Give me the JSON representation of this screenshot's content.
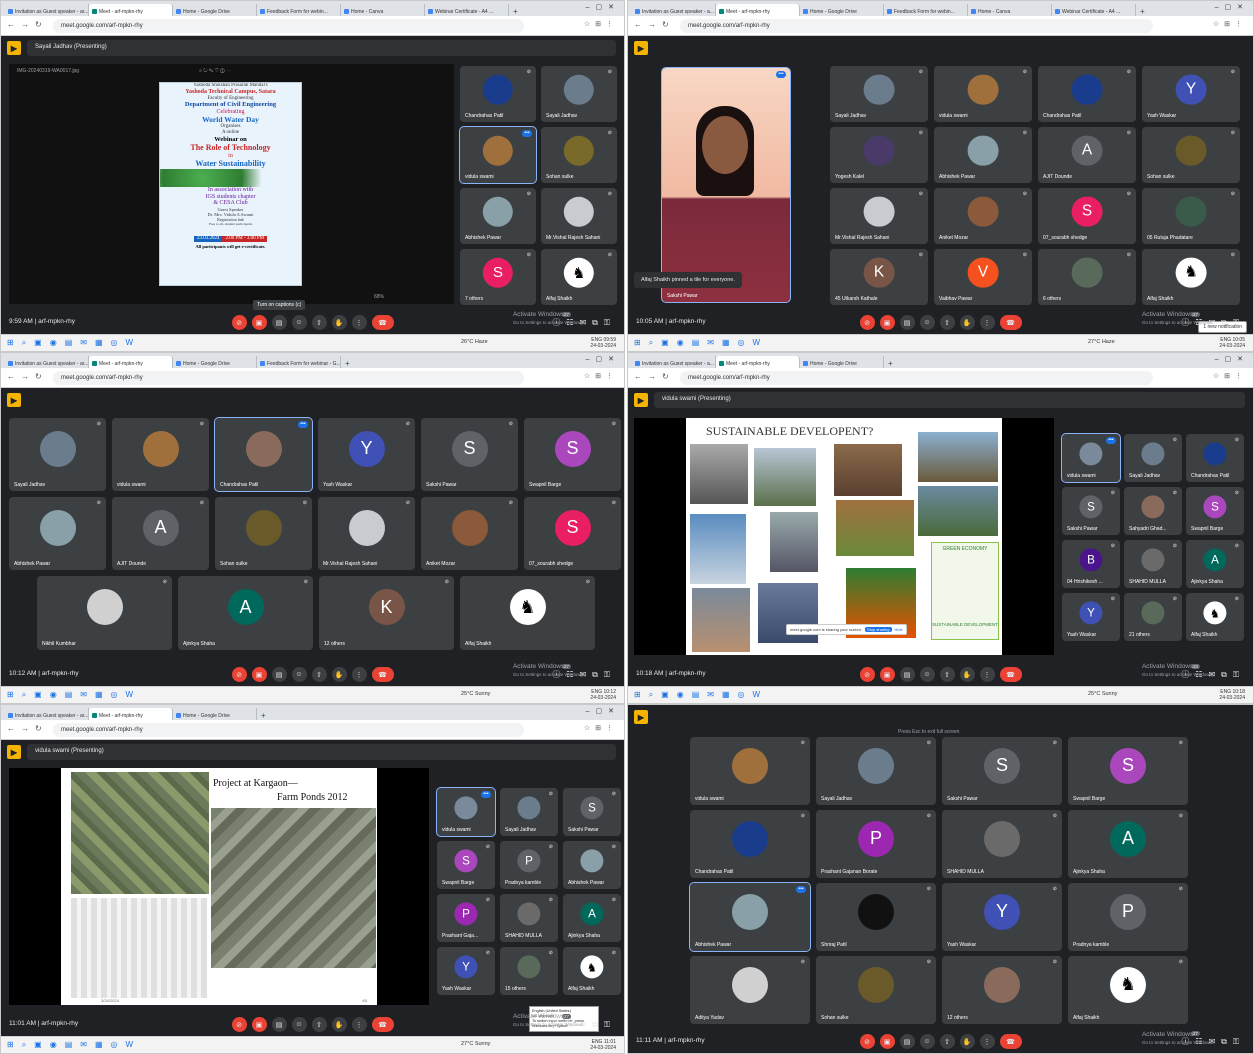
{
  "panels": [
    {
      "tabs": [
        "Invitation as Guest speaker - ar...",
        "Meet - arf-mpkn-rhy",
        "Home - Google Drive",
        "Feedback Form for webin...",
        "Home - Canva",
        "Webinar Certificate - A4 ..."
      ],
      "url": "meet.google.com/arf-mpkn-rhy",
      "presenting": "Sayali Jadhav (Presenting)",
      "image_title": "IMG-20240319-WA0017.jpg",
      "zoom": "68%",
      "poster": {
        "l1": "Yashoda Shikshan Prasarak Mandal's",
        "l2": "Yashoda Technical Campus, Satara",
        "l3": "Faculty of Engineering",
        "l4": "Department of Civil Engineering",
        "l5": "Celebrating",
        "l6": "World Water Day",
        "l7": "Organises",
        "l8": "A online",
        "l9": "Webinar on",
        "l10": "The Role of Technology",
        "l11": "in",
        "l12": "Water Sustainability",
        "l13": "In association with",
        "l14": "IGS students chapter",
        "l15": "& CESA Club",
        "l16": "Guest Speaker",
        "l17": "Dr. Mrs. Vidula A.Swami",
        "l18": "Registration link",
        "l19": "Free to all, student participants",
        "l20": "23.03.2024",
        "l21": "2.00 PM - 3.00 PM",
        "l22": "All participants will get e-certificate."
      },
      "tiles": [
        {
          "name": "Chandrahas Patil",
          "av": "",
          "color": "#1a3c8c"
        },
        {
          "name": "Sayali Jadhav",
          "av": "",
          "color": "#6b7d8c"
        },
        {
          "name": "vidula swami",
          "av": "",
          "color": "#a0703c",
          "spk": true
        },
        {
          "name": "Sohan sulke",
          "av": "",
          "color": "#7a6a2a"
        },
        {
          "name": "Abhishek Pawar",
          "av": "",
          "color": "#8aa0a8"
        },
        {
          "name": "Mr.Vishal Rajesh Sahani",
          "av": "",
          "color": "#c8ccd0"
        },
        {
          "name": "7 others",
          "av": "S",
          "color": "#e91e63"
        },
        {
          "name": "Alfaj Shaikh",
          "av": "♞",
          "color": "#ffffff"
        }
      ],
      "tooltip": "Turn on captions (c)",
      "time": "9:59 AM",
      "code": "arf-mpkn-rhy",
      "activate": "Activate Windows",
      "activate_sub": "Go to Settings to activate Windows.",
      "weather": "26°C  Haze",
      "tray_time": "09:59",
      "tray_date": "24-03-2024",
      "lang": "ENG",
      "people": "27"
    },
    {
      "tabs": [
        "Invitation as Guest speaker - a...",
        "Meet - arf-mpkn-rhy",
        "Home - Google Drive",
        "Feedback Form for webin...",
        "Home - Canva",
        "Webinar Certificate - A4 ..."
      ],
      "url": "meet.google.com/arf-mpkn-rhy",
      "pinned_name": "Sakshi Pawar",
      "toast": "Alfaj Shaikh pinned a tile for everyone.",
      "tiles": [
        {
          "name": "Sayali Jadhav",
          "av": "",
          "color": "#6b7d8c"
        },
        {
          "name": "vidula swami",
          "av": "",
          "color": "#a0703c"
        },
        {
          "name": "Chandrahas Patil",
          "av": "",
          "color": "#1a3c8c"
        },
        {
          "name": "Yash Waskar",
          "av": "Y",
          "color": "#3f51b5"
        },
        {
          "name": "Yogesh Kalel",
          "av": "",
          "color": "#4a3a6a"
        },
        {
          "name": "Abhishek Pawar",
          "av": "",
          "color": "#8aa0a8"
        },
        {
          "name": "AJIT Dounde",
          "av": "A",
          "color": "#5f6368"
        },
        {
          "name": "Sohan sulke",
          "av": "",
          "color": "#6a5a2a"
        },
        {
          "name": "Mr.Vishal Rajesh Sahani",
          "av": "",
          "color": "#c8ccd0"
        },
        {
          "name": "Aniket Mozar",
          "av": "",
          "color": "#8a5a3a"
        },
        {
          "name": "07_sourabh shedge",
          "av": "S",
          "color": "#e91e63"
        },
        {
          "name": "05 Rutuja Phadatare",
          "av": "",
          "color": "#3a5a4a"
        },
        {
          "name": "45 Utkarsh Kathale",
          "av": "K",
          "color": "#795548"
        },
        {
          "name": "Vaibhav Pawar",
          "av": "V",
          "color": "#f4511e"
        },
        {
          "name": "6 others",
          "av": "",
          "color": "#5a6a5a"
        },
        {
          "name": "Alfaj Shaikh",
          "av": "♞",
          "color": "#ffffff"
        }
      ],
      "time": "10:05 AM",
      "code": "arf-mpkn-rhy",
      "activate": "Activate Windows",
      "activate_sub": "Go to Settings to activate Windows.",
      "weather": "27°C  Haze",
      "tray_time": "10:05",
      "tray_date": "24-03-2024",
      "lang": "ENG",
      "people": "27",
      "notif": "1 new notification"
    },
    {
      "tabs": [
        "Invitation as Guest speaker - ar...",
        "Meet - arf-mpkn-rhy",
        "Home - Google Drive",
        "Feedback Form for webinar - G..."
      ],
      "url": "meet.google.com/arf-mpkn-rhy",
      "tiles": [
        {
          "name": "Sayali Jadhav",
          "av": "",
          "color": "#6b7d8c"
        },
        {
          "name": "vidula swami",
          "av": "",
          "color": "#a0703c"
        },
        {
          "name": "Chandrahas Patil",
          "av": "",
          "color": "#8a6a5a",
          "spk": true
        },
        {
          "name": "Yash Waskar",
          "av": "Y",
          "color": "#3f51b5"
        },
        {
          "name": "Sakshi Pawar",
          "av": "S",
          "color": "#5f6368"
        },
        {
          "name": "Swapnil Barge",
          "av": "S",
          "color": "#ab47bc"
        },
        {
          "name": "Abhishek Pawar",
          "av": "",
          "color": "#8aa0a8"
        },
        {
          "name": "AJIT Dounde",
          "av": "A",
          "color": "#5f6368"
        },
        {
          "name": "Sohan sulke",
          "av": "",
          "color": "#6a5a2a"
        },
        {
          "name": "Mr.Vishal Rajesh Sahani",
          "av": "",
          "color": "#c8ccd0"
        },
        {
          "name": "Aniket Mozar",
          "av": "",
          "color": "#8a5a3a"
        },
        {
          "name": "07_sourabh shedge",
          "av": "S",
          "color": "#e91e63"
        },
        {
          "name": "Nikhil Kumbhar",
          "av": "",
          "color": "#d0d0d0"
        },
        {
          "name": "Ajinkya Shaha",
          "av": "A",
          "color": "#00695c"
        },
        {
          "name": "12 others",
          "av": "K",
          "color": "#795548"
        },
        {
          "name": "Alfaj Shaikh",
          "av": "♞",
          "color": "#ffffff"
        }
      ],
      "time": "10:12 AM",
      "code": "arf-mpkn-rhy",
      "activate": "Activate Windows",
      "activate_sub": "Go to Settings to activate Windows.",
      "weather": "25°C  Sunny",
      "tray_time": "10:12",
      "tray_date": "24-03-2024",
      "lang": "ENG",
      "people": "27"
    },
    {
      "tabs": [
        "Invitation as Guest speaker - a...",
        "Meet - arf-mpkn-rhy",
        "Home - Google Drive"
      ],
      "url": "meet.google.com/arf-mpkn-rhy",
      "presenting": "vidula swami (Presenting)",
      "slide_title": "SUSTAINABLE DEVELOPENT?",
      "slide_note": "GREEN ECONOMY",
      "slide_note2": "SUSTAINABLE DEVELOPMENT",
      "share_msg": "meet.google.com is sharing your screen.",
      "stop_share": "Stop sharing",
      "hide": "Hide",
      "tiles": [
        {
          "name": "vidula swami",
          "av": "",
          "color": "#7a8a9a",
          "spk": true
        },
        {
          "name": "Sayali Jadhav",
          "av": "",
          "color": "#6b7d8c"
        },
        {
          "name": "Chandrahas Patil",
          "av": "",
          "color": "#1a3c8c"
        },
        {
          "name": "Sakshi Pawar",
          "av": "S",
          "color": "#5f6368"
        },
        {
          "name": "Sahyadri Ghad...",
          "av": "",
          "color": "#8a6a5a"
        },
        {
          "name": "Swapnil Barge",
          "av": "S",
          "color": "#ab47bc"
        },
        {
          "name": "04 Hrishikesh ...",
          "av": "B",
          "color": "#4a148c"
        },
        {
          "name": "SHAHID MULLA",
          "av": "",
          "color": "#6a6a6a"
        },
        {
          "name": "Ajinkya Shaha",
          "av": "A",
          "color": "#00695c"
        },
        {
          "name": "Yash Waskar",
          "av": "Y",
          "color": "#3f51b5"
        },
        {
          "name": "21 others",
          "av": "",
          "color": "#5a6a5a"
        },
        {
          "name": "Alfaj Shaikh",
          "av": "♞",
          "color": "#ffffff"
        }
      ],
      "time": "10:18 AM",
      "code": "arf-mpkn-rhy",
      "activate": "Activate Windows",
      "activate_sub": "Go to Settings to activate Windows.",
      "weather": "25°C  Sunny",
      "tray_time": "10:18",
      "tray_date": "24-03-2024",
      "lang": "ENG",
      "people": "33"
    },
    {
      "tabs": [
        "Invitation as Guest speaker - ar...",
        "Meet - arf-mpkn-rhy",
        "Home - Google Drive"
      ],
      "url": "meet.google.com/arf-mpkn-rhy",
      "presenting": "vidula swami (Presenting)",
      "slide_title": "Project at Kargaon—",
      "slide_title2": "Farm Ponds 2012",
      "slide_date": "3/24/2024",
      "slide_page": "63",
      "tiles": [
        {
          "name": "vidula swami",
          "av": "",
          "color": "#7a8a9a",
          "spk": true
        },
        {
          "name": "Sayali Jadhav",
          "av": "",
          "color": "#6b7d8c"
        },
        {
          "name": "Sakshi Pawar",
          "av": "S",
          "color": "#5f6368"
        },
        {
          "name": "Swapnil Barge",
          "av": "S",
          "color": "#ab47bc"
        },
        {
          "name": "Pradnya kamble",
          "av": "P",
          "color": "#5f6368"
        },
        {
          "name": "Abhishek Pawar",
          "av": "",
          "color": "#8aa0a8"
        },
        {
          "name": "Prashant Gaja...",
          "av": "P",
          "color": "#9c27b0"
        },
        {
          "name": "SHAHID MULLA",
          "av": "",
          "color": "#6a6a6a"
        },
        {
          "name": "Ajinkya Shaha",
          "av": "A",
          "color": "#00695c"
        },
        {
          "name": "Yash Waskar",
          "av": "Y",
          "color": "#3f51b5"
        },
        {
          "name": "15 others",
          "av": "",
          "color": "#5a6a5a"
        },
        {
          "name": "Alfaj Shaikh",
          "av": "♞",
          "color": "#ffffff"
        }
      ],
      "kb_popup": [
        "English (United States)",
        "US keyboard",
        "To switch input methods, press",
        "Windows key+Space"
      ],
      "time": "11:01 AM",
      "code": "arf-mpkn-rhy",
      "activate": "Activate Windows",
      "activate_sub": "Go to Settings to activate Windows.",
      "weather": "27°C  Sunny",
      "tray_time": "11:01",
      "tray_date": "24-03-2024",
      "lang": "ENG",
      "people": "27"
    },
    {
      "esc_hint": "Press  Esc  to exit full screen",
      "tiles": [
        {
          "name": "vidula swami",
          "av": "",
          "color": "#a0703c"
        },
        {
          "name": "Sayali Jadhav",
          "av": "",
          "color": "#6b7d8c"
        },
        {
          "name": "Sakshi Pawar",
          "av": "S",
          "color": "#5f6368"
        },
        {
          "name": "Swapnil Barge",
          "av": "S",
          "color": "#ab47bc"
        },
        {
          "name": "Chandrahas Patil",
          "av": "",
          "color": "#1a3c8c"
        },
        {
          "name": "Prashant Gajanan Borate",
          "av": "P",
          "color": "#9c27b0"
        },
        {
          "name": "SHAHID MULLA",
          "av": "",
          "color": "#6a6a6a"
        },
        {
          "name": "Ajinkya Shaha",
          "av": "A",
          "color": "#00695c"
        },
        {
          "name": "Abhishek Pawar",
          "av": "",
          "color": "#8aa0a8",
          "spk": true
        },
        {
          "name": "Shriraj Patil",
          "av": "",
          "color": "#111111"
        },
        {
          "name": "Yash Waskar",
          "av": "Y",
          "color": "#3f51b5"
        },
        {
          "name": "Pradnya kamble",
          "av": "P",
          "color": "#5f6368"
        },
        {
          "name": "Aditya Yadav",
          "av": "",
          "color": "#d0d0d0"
        },
        {
          "name": "Sohan sulke",
          "av": "",
          "color": "#6a5a2a"
        },
        {
          "name": "12 others",
          "av": "",
          "color": "#8a6a5a"
        },
        {
          "name": "Alfaj Shaikh",
          "av": "♞",
          "color": "#ffffff"
        }
      ],
      "time": "11:11 AM",
      "code": "arf-mpkn-rhy",
      "activate": "Activate Windows",
      "activate_sub": "Go to Settings to activate Windows.",
      "people": "27"
    }
  ]
}
